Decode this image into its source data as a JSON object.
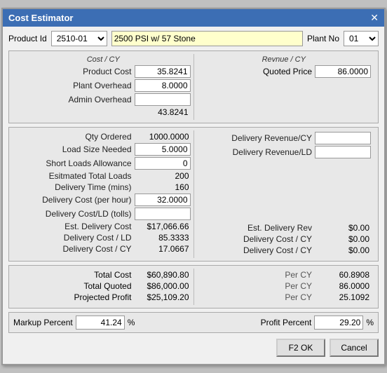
{
  "window": {
    "title": "Cost Estimator",
    "close_label": "✕"
  },
  "top_bar": {
    "product_id_label": "Product Id",
    "product_id_value": "2510-01",
    "description_value": "2500 PSI w/ 57 Stone",
    "plant_no_label": "Plant No",
    "plant_no_value": "01"
  },
  "cost_section": {
    "cost_header": "Cost / CY",
    "rev_header": "Revnue / CY",
    "rows": [
      {
        "label": "Product Cost",
        "value": "35.8241"
      },
      {
        "label": "Plant Overhead",
        "value": "8.0000"
      },
      {
        "label": "Admin Overhead",
        "value": ""
      },
      {
        "label": "",
        "value": "43.8241"
      }
    ],
    "quoted_price_label": "Quoted Price",
    "quoted_price_value": "86.0000"
  },
  "delivery_section": {
    "left_rows": [
      {
        "label": "Qty Ordered",
        "value": "1000.0000"
      },
      {
        "label": "Load Size Needed",
        "value": "5.0000"
      },
      {
        "label": "Short Loads Allowance",
        "value": "0"
      },
      {
        "label": "Esitmated Total Loads",
        "value": "200"
      },
      {
        "label": "Delivery Time (mins)",
        "value": "160"
      },
      {
        "label": "Delivery Cost (per hour)",
        "value": "32.0000"
      },
      {
        "label": "Delivery Cost/LD (tolls)",
        "value": ""
      },
      {
        "label": "Est. Delivery Cost",
        "value": "$17,066.66"
      },
      {
        "label": "Delivery Cost / LD",
        "value": "85.3333"
      },
      {
        "label": "Delivery Cost / CY",
        "value": "17.0667"
      }
    ],
    "right_rows": [
      {
        "label": "Delivery Revenue/CY",
        "value": ""
      },
      {
        "label": "Delivery Revenue/LD",
        "value": ""
      },
      {
        "label": "",
        "value": ""
      },
      {
        "label": "",
        "value": ""
      },
      {
        "label": "",
        "value": ""
      },
      {
        "label": "",
        "value": ""
      },
      {
        "label": "",
        "value": ""
      },
      {
        "label": "Est. Delivery Rev",
        "value": "$0.00"
      },
      {
        "label": "Delivery Cost / CY",
        "value": "$0.00"
      },
      {
        "label": "Delivery Cost / CY",
        "value": "$0.00"
      }
    ]
  },
  "summary_section": {
    "left_rows": [
      {
        "label": "Total Cost",
        "value": "$60,890.80",
        "per_label": "Per CY",
        "per_value": "60.8908"
      },
      {
        "label": "Total Quoted",
        "value": "$86,000.00",
        "per_label": "Per CY",
        "per_value": "86.0000"
      },
      {
        "label": "Projected Profit",
        "value": "$25,109.20",
        "per_label": "Per CY",
        "per_value": "25.1092"
      }
    ]
  },
  "markup_row": {
    "markup_label": "Markup Percent",
    "markup_value": "41.24",
    "markup_pct": "%",
    "profit_label": "Profit Percent",
    "profit_value": "29.20",
    "profit_pct": "%"
  },
  "buttons": {
    "ok_label": "F2  OK",
    "cancel_label": "Cancel"
  }
}
